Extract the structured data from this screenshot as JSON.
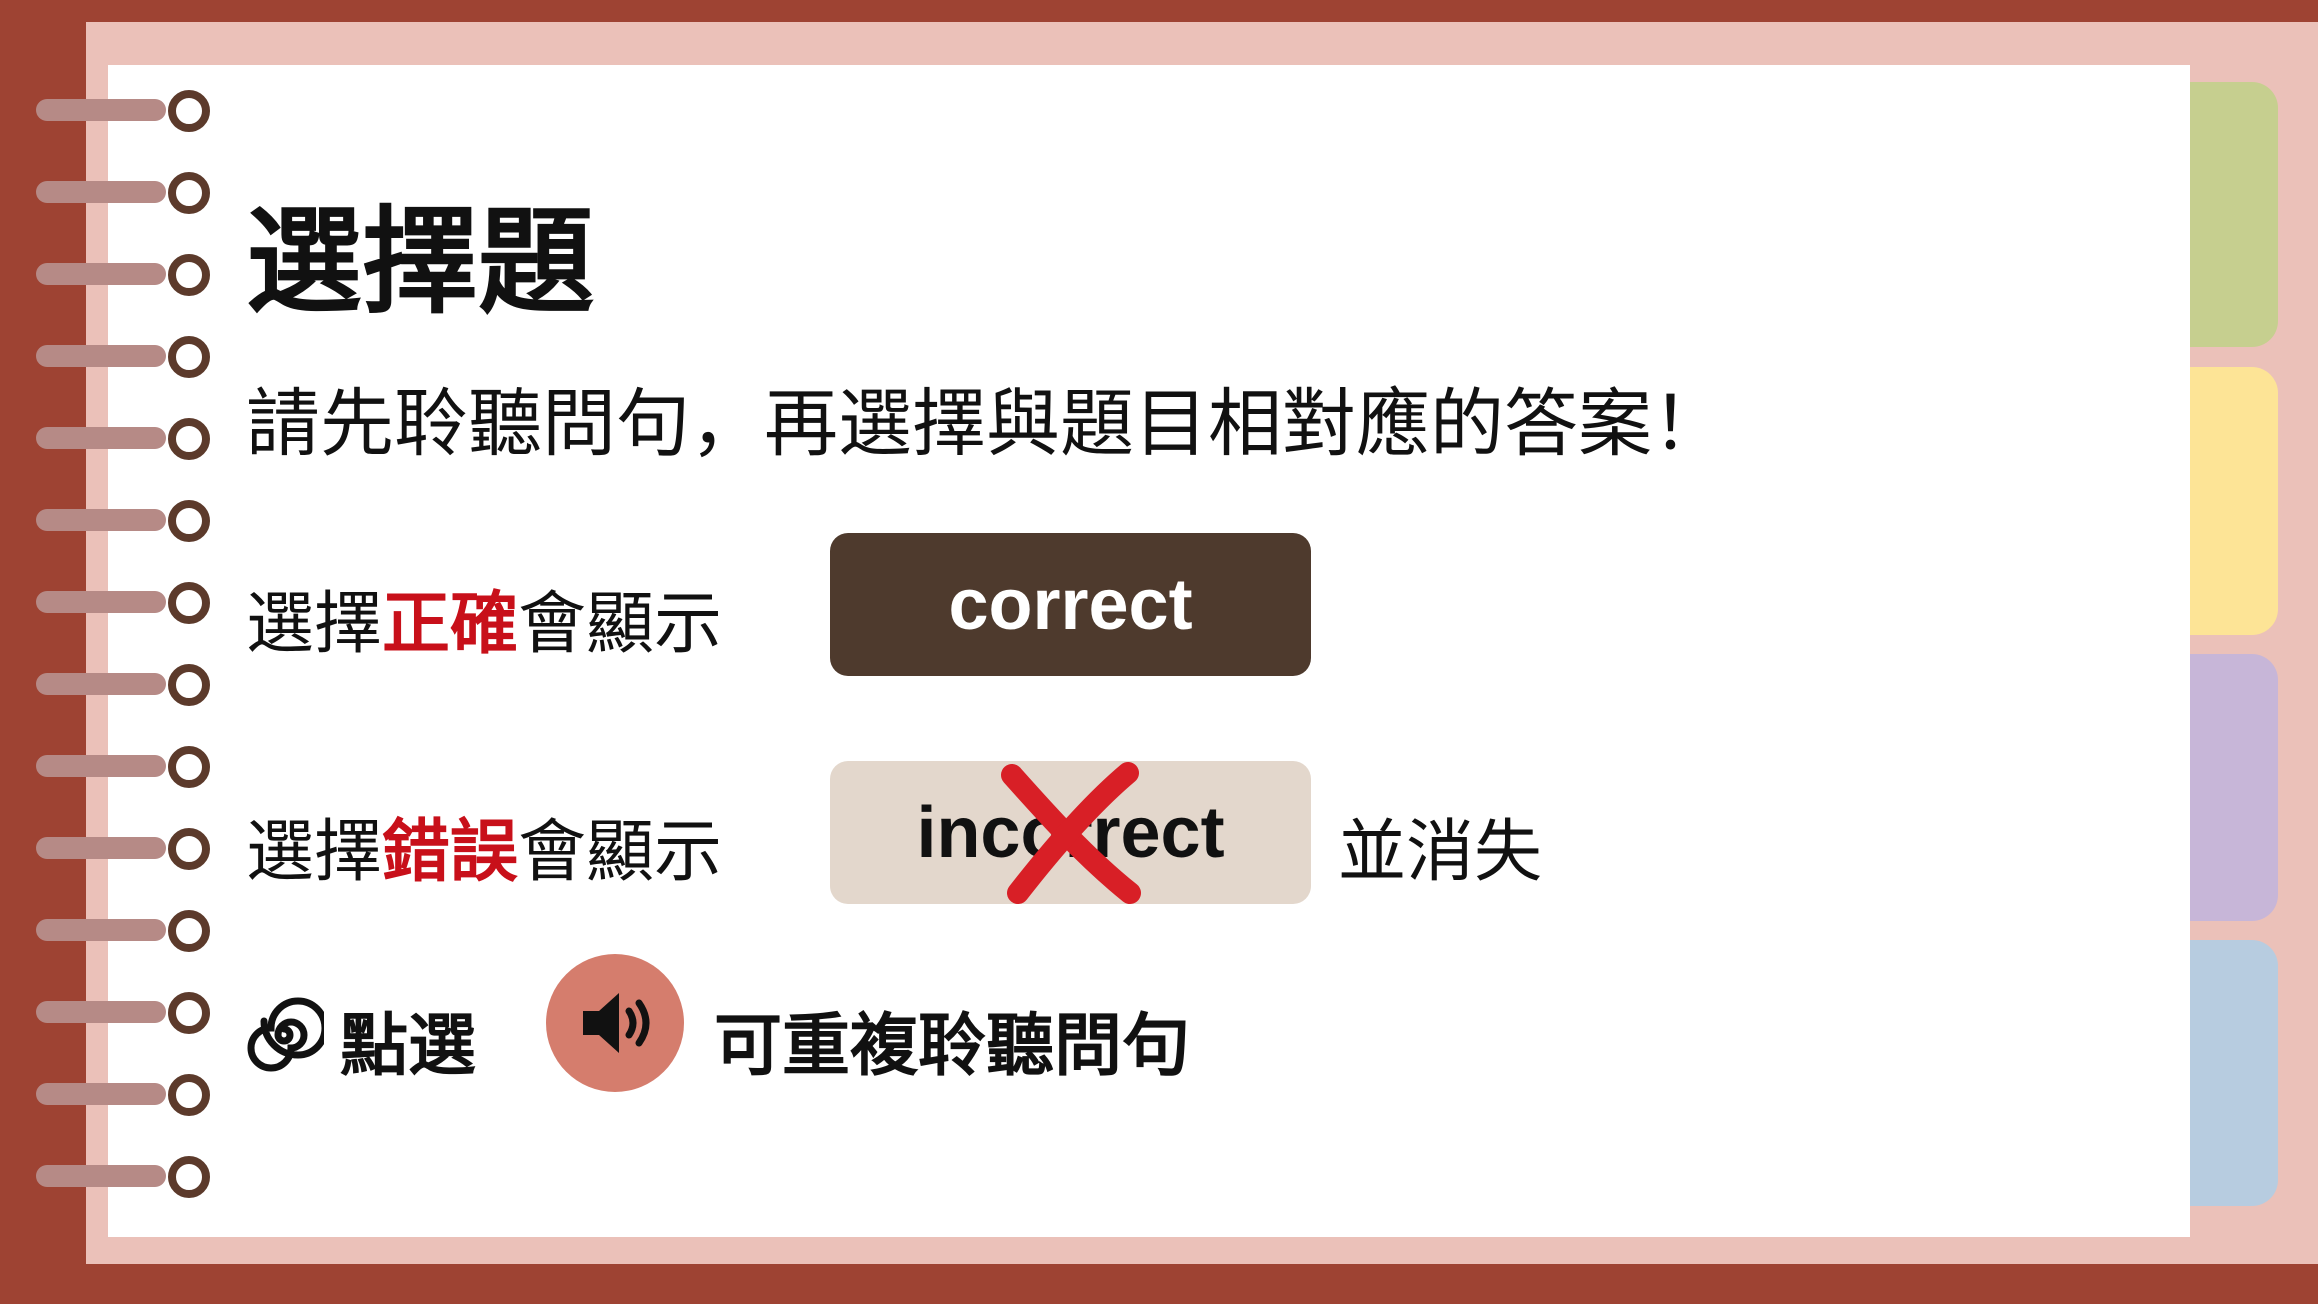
{
  "heading": "選擇題",
  "instruction": "請先聆聽問句，再選擇與題目相對應的答案！",
  "correct_row": {
    "prefix": "選擇",
    "keyword": "正確",
    "suffix": "會顯示",
    "button_label": "correct"
  },
  "incorrect_row": {
    "prefix": "選擇",
    "keyword": "錯誤",
    "suffix": "會顯示",
    "button_label": "incorrect",
    "trailing": "並消失"
  },
  "replay_row": {
    "lead": "點選",
    "trailing": "可重複聆聽問句"
  },
  "colors": {
    "page_border": "#9e4333",
    "keyword_red": "#c8101a",
    "correct_button": "#4e3a2d",
    "incorrect_button": "#e3d7cc",
    "speaker_button": "#d57d6d",
    "cross_mark": "#d81f26"
  },
  "icons": {
    "cross": "x-mark-icon",
    "spiral": "spiral-icon",
    "speaker": "speaker-icon"
  }
}
